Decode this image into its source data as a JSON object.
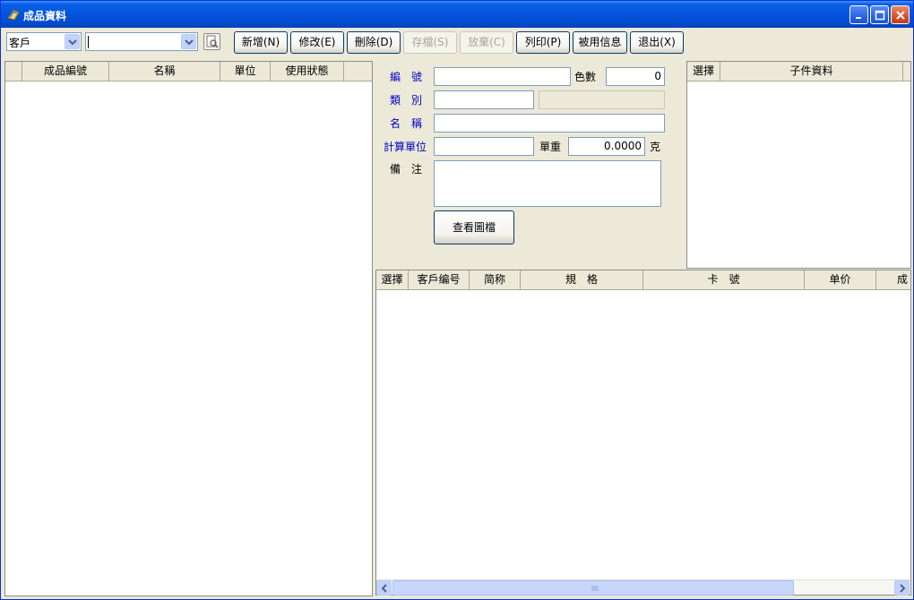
{
  "window": {
    "title": "成品資料"
  },
  "toolbar": {
    "filter_combo_value": "客戶",
    "search_combo_value": "",
    "buttons": {
      "add": "新增(N)",
      "modify": "修改(E)",
      "delete": "刪除(D)",
      "save": "存檔(S)",
      "cancel": "放棄(C)",
      "print": "列印(P)",
      "usage": "被用信息",
      "exit": "退出(X)"
    }
  },
  "left_grid": {
    "columns": [
      "成品編號",
      "名稱",
      "單位",
      "使用狀態"
    ]
  },
  "form": {
    "code_label": "編　號",
    "code_value": "",
    "color_count_label": "色數",
    "color_count_value": "0",
    "category_label": "類　別",
    "category_value": "",
    "category_desc_value": "",
    "name_label": "名　稱",
    "name_value": "",
    "unit_label": "計算單位",
    "unit_value": "",
    "unit_weight_label": "單重",
    "unit_weight_value": "0.0000",
    "gram_label": "克",
    "remark_label": "備　注",
    "remark_value": "",
    "view_image_button": "查看圖檔"
  },
  "child_grid": {
    "columns": [
      "選擇",
      "子件資料"
    ]
  },
  "customer_grid": {
    "columns": [
      "選擇",
      "客戶编号",
      "简称",
      "規　格",
      "卡　號",
      "单价",
      "成"
    ]
  },
  "colors": {
    "titlebar": "#0453dd",
    "face": "#ece9d8",
    "label_blue": "#0000c8",
    "border": "#7f9db9"
  }
}
